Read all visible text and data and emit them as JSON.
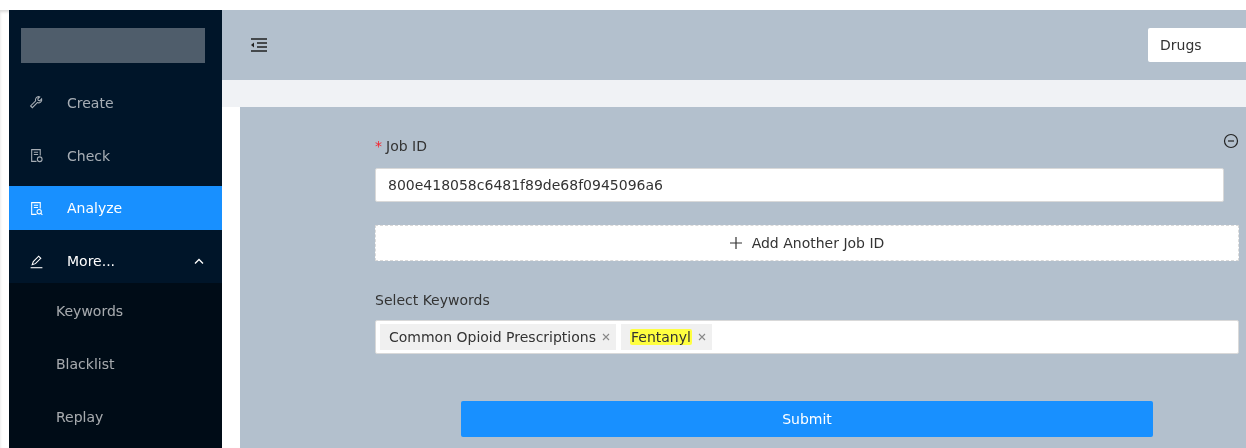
{
  "sidebar": {
    "items": [
      {
        "label": "Create",
        "kind": "wrench",
        "selected": false
      },
      {
        "label": "Check",
        "kind": "check",
        "selected": false
      },
      {
        "label": "Analyze",
        "kind": "search",
        "selected": true
      },
      {
        "label": "More...",
        "kind": "pen",
        "selected": false,
        "expanded": true,
        "children": [
          {
            "label": "Keywords",
            "selected": false
          },
          {
            "label": "Blacklist",
            "selected": false
          },
          {
            "label": "Replay",
            "selected": false
          }
        ]
      }
    ]
  },
  "header": {
    "category_select": "Drugs"
  },
  "form": {
    "job_id": {
      "label": "Job ID",
      "required_mark": "*",
      "value": "800e418058c6481f89de68f0945096a6"
    },
    "add_button": "Add Another Job ID",
    "keywords": {
      "label": "Select Keywords",
      "tags": [
        {
          "label": "Common Opioid Prescriptions",
          "highlighted": false
        },
        {
          "label": "Fentanyl",
          "highlighted": true
        }
      ]
    },
    "submit": "Submit"
  }
}
